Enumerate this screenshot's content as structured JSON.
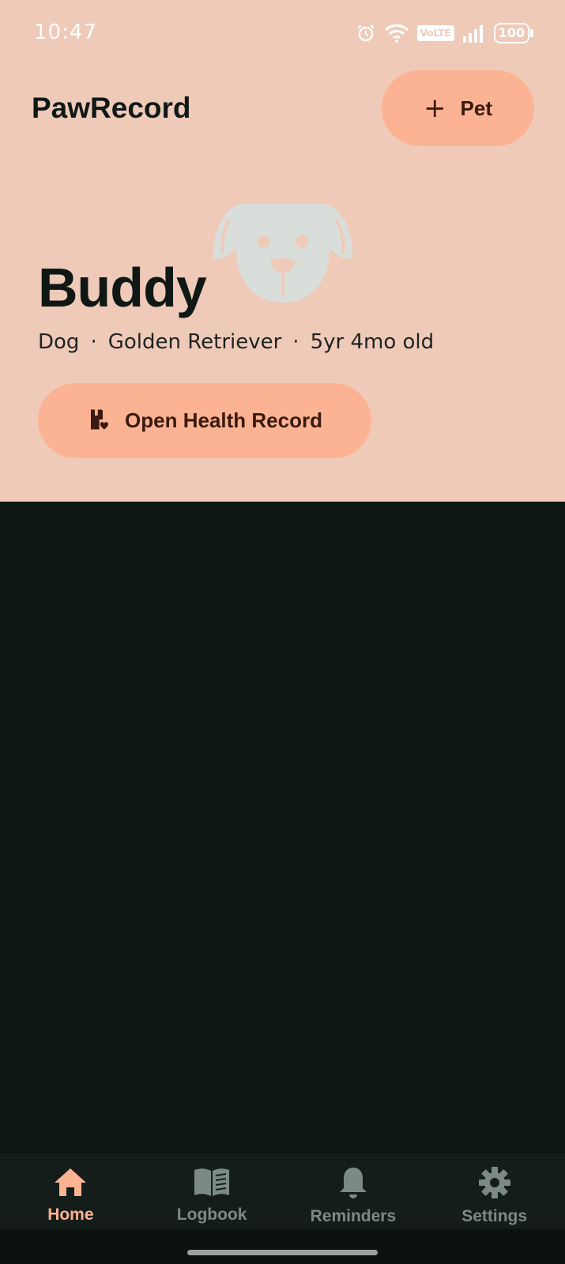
{
  "status_bar": {
    "time": "10:47",
    "volte": "VoLTE",
    "battery": "100"
  },
  "header": {
    "app_title": "PawRecord",
    "add_pet_plus": "+",
    "add_pet_label": "Pet"
  },
  "pet": {
    "name": "Buddy",
    "species": "Dog",
    "breed": "Golden Retriever",
    "age": "5yr 4mo old",
    "separator": "·",
    "open_record_label": "Open Health Record"
  },
  "bottom_nav": {
    "items": [
      {
        "label": "Home",
        "icon": "home-icon",
        "active": true
      },
      {
        "label": "Logbook",
        "icon": "book-icon",
        "active": false
      },
      {
        "label": "Reminders",
        "icon": "bell-icon",
        "active": false
      },
      {
        "label": "Settings",
        "icon": "gear-icon",
        "active": false
      }
    ]
  },
  "colors": {
    "hero_background": "#efcab9",
    "accent": "#fcb393",
    "accent_text": "#3a1a0e",
    "page_background": "#0e1614",
    "nav_background": "#151d1b",
    "nav_inactive": "#7c8a86",
    "illustration": "#d9dedb"
  }
}
